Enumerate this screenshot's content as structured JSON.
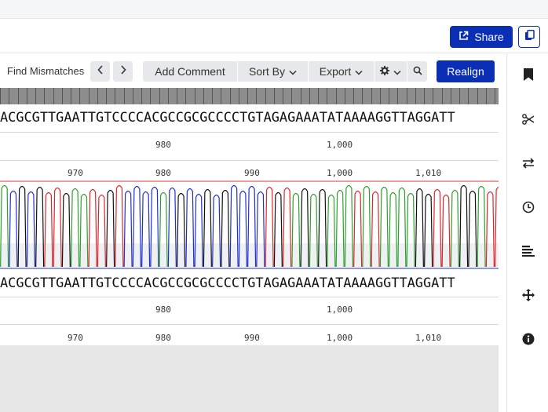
{
  "header": {
    "share_label": "Share",
    "share_icon": "external-link-icon",
    "copy_icon": "copy-icon"
  },
  "toolbar": {
    "find_mismatches_label": "Find Mismatches",
    "prev_icon": "chevron-left-icon",
    "next_icon": "chevron-right-icon",
    "add_comment_label": "Add Comment",
    "sort_by_label": "Sort By",
    "export_label": "Export",
    "settings_icon": "gear-icon",
    "search_icon": "search-icon",
    "realign_label": "Realign"
  },
  "sidebar": {
    "icons": [
      "bookmark-icon",
      "scissors-icon",
      "swap-arrows-icon",
      "clock-icon",
      "align-left-icon",
      "move-icon",
      "info-icon"
    ]
  },
  "alignment": {
    "sequence": "ACGCGTTGAATTGTCCCCACGCCGCGCCCCTGTAGAGAAATATAAAAGGTTAGGATT",
    "reference_ruler": [
      "980",
      "1,000"
    ],
    "read_ruler": [
      "970",
      "980",
      "990",
      "1,000",
      "1,010"
    ]
  },
  "colors": {
    "accent": "#0a2fb5",
    "base_A": "#2ca02c",
    "base_C": "#1f2fd0",
    "base_G": "#111111",
    "base_T": "#e0252a",
    "track_bg": "#eef0f3"
  }
}
